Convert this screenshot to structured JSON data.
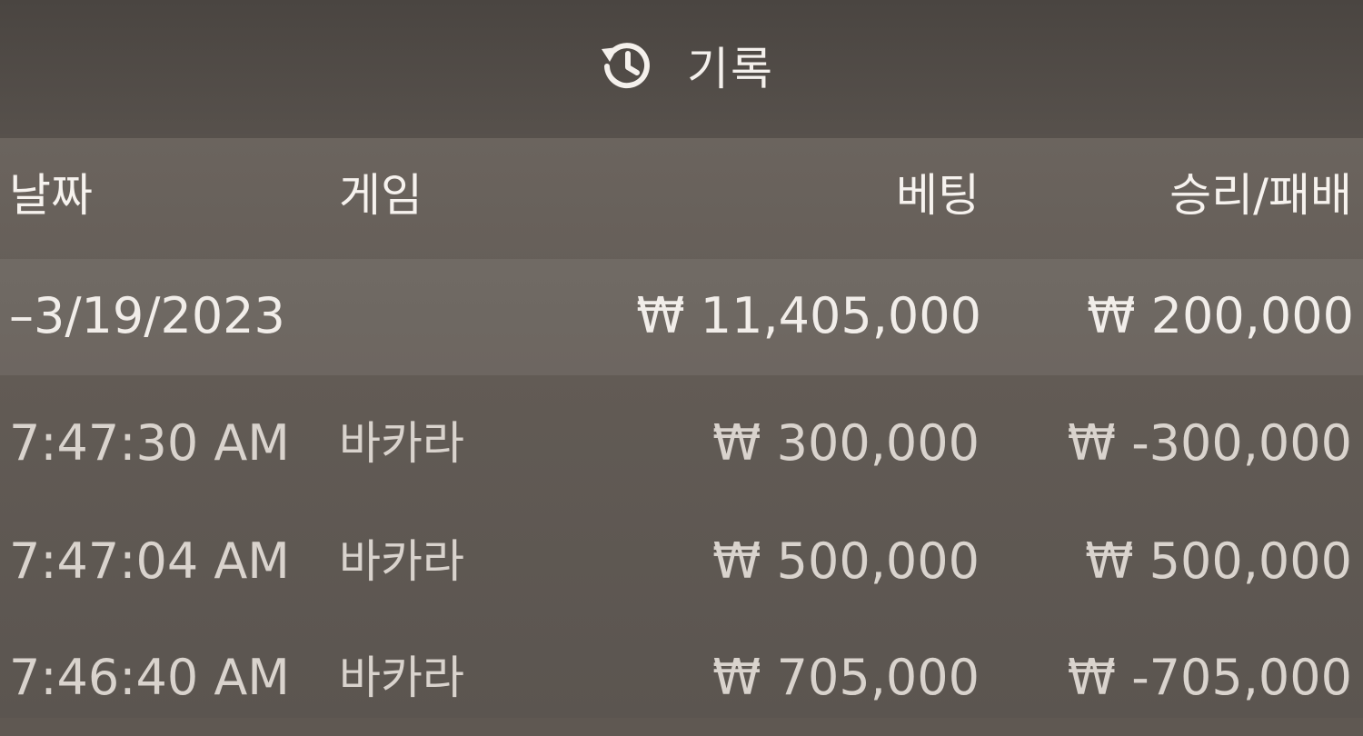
{
  "header": {
    "icon": "history-icon",
    "title": "기록"
  },
  "columns": {
    "date": "날짜",
    "game": "게임",
    "bet": "베팅",
    "result": "승리/패배"
  },
  "summary": {
    "date": "–3/19/2023",
    "bet": "₩ 11,405,000",
    "result": "₩ 200,000"
  },
  "rows": [
    {
      "time": "7:47:30 AM",
      "game": "바카라",
      "bet": "₩ 300,000",
      "result": "₩ -300,000"
    },
    {
      "time": "7:47:04 AM",
      "game": "바카라",
      "bet": "₩ 500,000",
      "result": "₩ 500,000"
    },
    {
      "time": "7:46:40 AM",
      "game": "바카라",
      "bet": "₩ 705,000",
      "result": "₩ -705,000"
    }
  ],
  "colors": {
    "header_bg": "#4d4844",
    "content_bg": "#645d57",
    "text": "#ece7e2"
  }
}
